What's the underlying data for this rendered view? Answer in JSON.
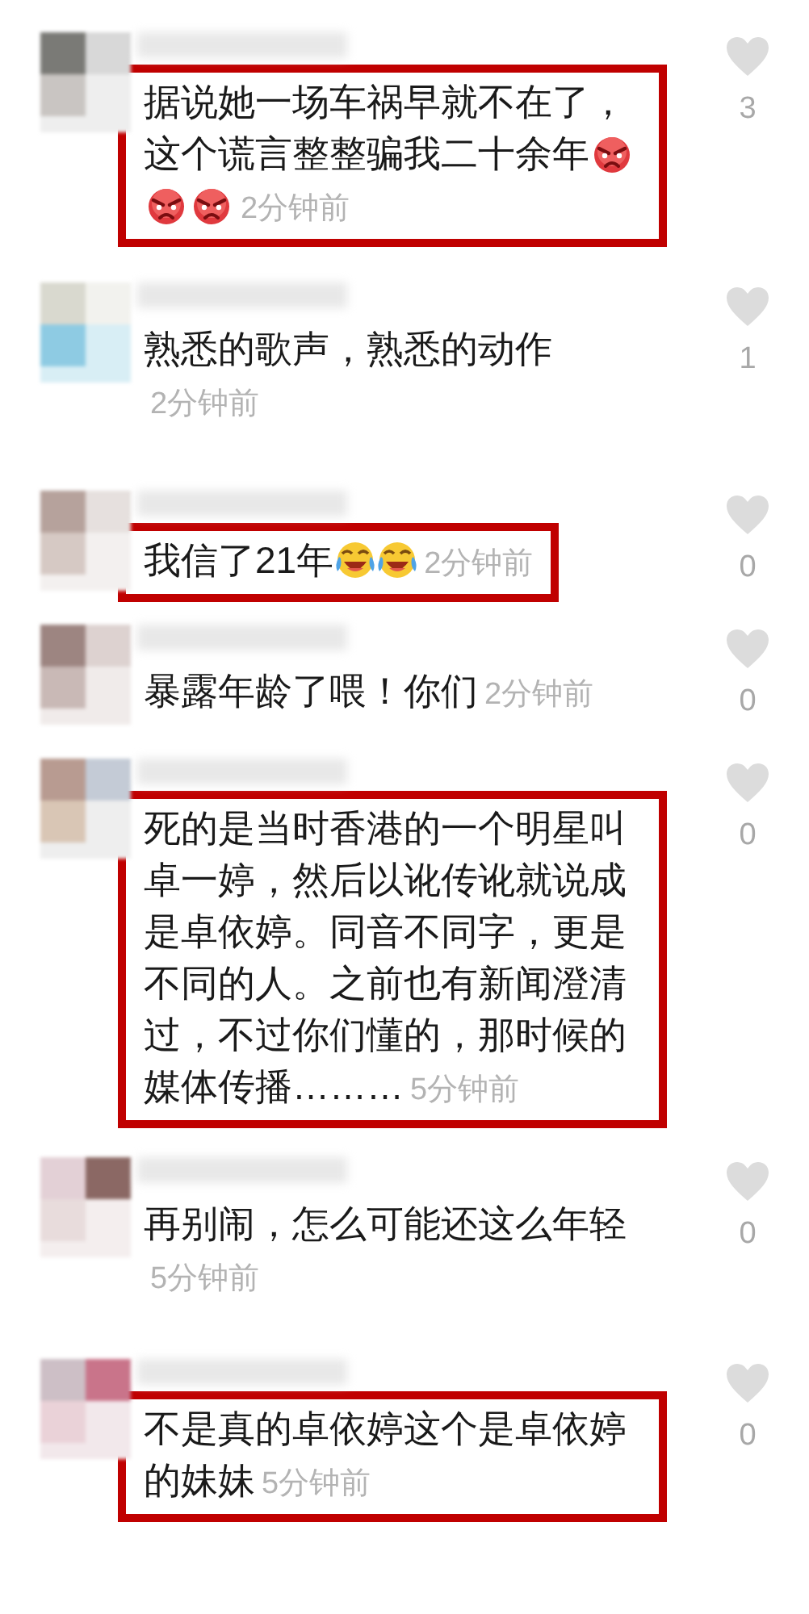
{
  "comments": [
    {
      "highlighted": true,
      "body": [
        {
          "kind": "text",
          "text": "据说她一场车祸早就不在了，"
        },
        {
          "kind": "text",
          "text": "这个谎言整整骗我二十余年"
        },
        {
          "kind": "angry_emoji"
        },
        {
          "kind": "angry_emoji"
        },
        {
          "kind": "angry_emoji"
        }
      ],
      "time": "2分钟前",
      "likes": "3"
    },
    {
      "highlighted": false,
      "body": [
        {
          "kind": "text",
          "text": "熟悉的歌声，熟悉的动作"
        }
      ],
      "time": "2分钟前",
      "likes": "1"
    },
    {
      "highlighted": true,
      "body": [
        {
          "kind": "text",
          "text": "我信了21年"
        },
        {
          "kind": "laughing_emoji"
        },
        {
          "kind": "laughing_emoji"
        }
      ],
      "time": "2分钟前",
      "likes": "0"
    },
    {
      "highlighted": false,
      "body": [
        {
          "kind": "text",
          "text": "暴露年龄了喂！你们"
        }
      ],
      "time": "2分钟前",
      "likes": "0"
    },
    {
      "highlighted": true,
      "body": [
        {
          "kind": "text",
          "text": "死的是当时香港的一个明星叫卓一婷，然后以讹传讹就说成是卓依婷。同音不同字，更是不同的人。之前也有新闻澄清过，不过你们懂的，那时候的"
        },
        {
          "kind": "text",
          "text": "媒体传播………"
        }
      ],
      "time": "5分钟前",
      "likes": "0"
    },
    {
      "highlighted": false,
      "body": [
        {
          "kind": "text",
          "text": "再别闹，怎么可能还这么年轻"
        }
      ],
      "time": "5分钟前",
      "likes": "0"
    },
    {
      "highlighted": true,
      "body": [
        {
          "kind": "text",
          "text": "不是真的卓依婷这个是卓依婷"
        },
        {
          "kind": "text",
          "text": "的妹妹"
        }
      ],
      "time": "5分钟前",
      "likes": "0"
    }
  ]
}
